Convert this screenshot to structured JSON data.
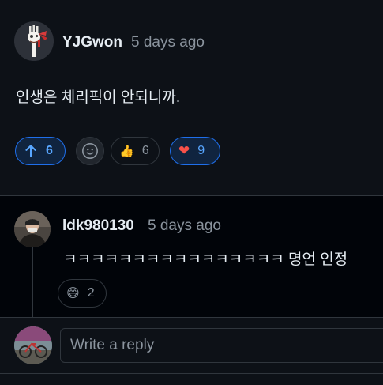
{
  "comment": {
    "author": "YJGwon",
    "time": "5 days ago",
    "body": "인생은 체리픽이 안되니까.",
    "upvote_count": "6",
    "reactions": [
      {
        "icon": "thumbs-up-icon",
        "glyph": "👍",
        "count": "6"
      },
      {
        "icon": "heart-icon",
        "glyph": "❤",
        "count": "9"
      }
    ]
  },
  "reply": {
    "author": "ldk980130",
    "time": "5 days ago",
    "body": "ㅋㅋㅋㅋㅋㅋㅋㅋㅋㅋㅋㅋㅋㅋㅋㅋ 명언 인정",
    "reactions": [
      {
        "icon": "grinning-face-icon",
        "glyph": "😄",
        "count": "2"
      }
    ]
  },
  "composer": {
    "placeholder": "Write a reply"
  },
  "colors": {
    "accent": "#58a6ff",
    "background": "#0d1117",
    "reply_background": "#010409",
    "border": "#30363d",
    "heart": "#f85149"
  }
}
